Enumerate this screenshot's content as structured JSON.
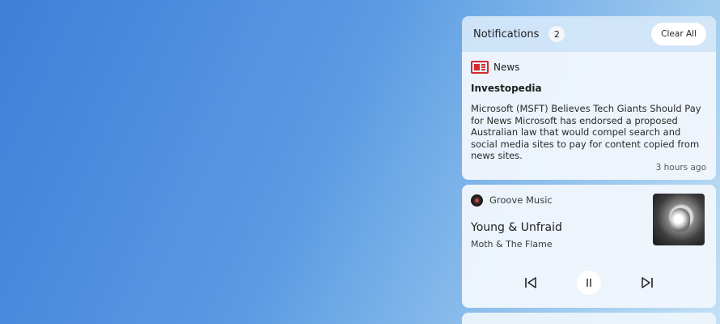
{
  "header": {
    "title": "Notifications",
    "count": "2",
    "clear_label": "Clear All"
  },
  "news": {
    "app_name": "News",
    "source": "Investopedia",
    "body": "Microsoft (MSFT) Believes Tech Giants Should Pay for News Microsoft has endorsed a proposed Australian law that would compel search and social media sites to pay for content copied from news sites.",
    "time": "3 hours ago",
    "icon": "news-icon",
    "accent_color": "#d8272f"
  },
  "music": {
    "app_name": "Groove Music",
    "song": "Young & Unfraid",
    "artist": "Moth & The Flame",
    "icon": "groove-music-icon",
    "controls": [
      "previous-track-icon",
      "pause-icon",
      "next-track-icon"
    ]
  }
}
